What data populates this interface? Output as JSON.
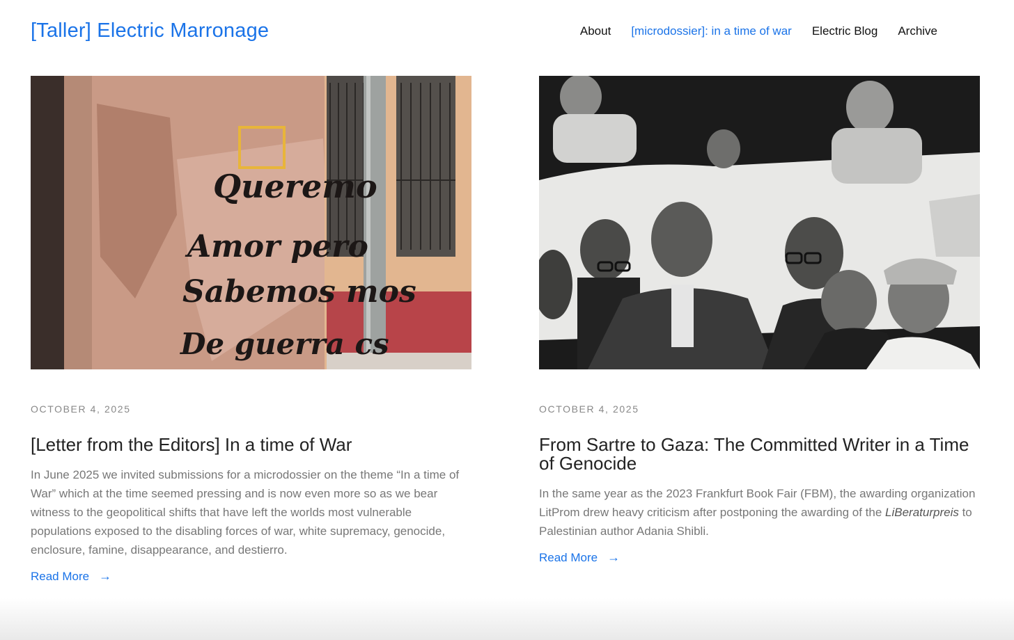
{
  "site": {
    "title": "[Taller] Electric Marronage"
  },
  "nav": {
    "items": [
      {
        "label": "About",
        "active": false
      },
      {
        "label": "[microdossier]: in a time of war",
        "active": true
      },
      {
        "label": "Electric Blog",
        "active": false
      },
      {
        "label": "Archive",
        "active": false
      }
    ]
  },
  "posts": [
    {
      "date": "OCTOBER 4, 2025",
      "title": "[Letter from the Editors] In a time of War",
      "excerpt": "In June 2025 we invited submissions for a microdossier on the theme “In a time of War” which at the time seemed pressing and is now even more so as we bear witness to the geopolitical shifts that have left the worlds most vulnerable populations exposed to the disabling forces of war, white supremacy, genocide, enclosure, famine, disappearance, and destierro.",
      "read_more": "Read More",
      "image_text": [
        "Queremo",
        "Amor pero",
        "Sabemos mos",
        "De guerra cs"
      ]
    },
    {
      "date": "OCTOBER 4, 2025",
      "title": "From Sartre to Gaza: The Committed Writer in a Time of Genocide",
      "excerpt_before": "In the same year as the 2023 Frankfurt Book Fair (FBM), the awarding organization LitProm drew heavy criticism after postponing the awarding of the ",
      "excerpt_italic": "LiBeraturpreis",
      "excerpt_after": " to Palestinian author Adania Shibli.",
      "read_more": "Read More"
    }
  ],
  "icons": {
    "arrow": "→"
  },
  "colors": {
    "accent": "#1a73e8",
    "text": "#222222",
    "muted": "#777777",
    "date": "#888888"
  }
}
